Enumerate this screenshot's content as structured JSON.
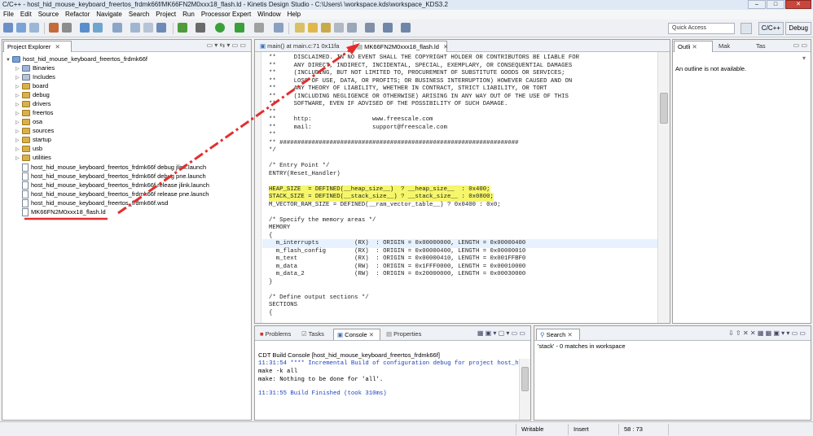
{
  "window": {
    "title": "C/C++ - host_hid_mouse_keyboard_freertos_frdmk66f/MK66FN2M0xxx18_flash.ld - Kinetis Design Studio - C:\\Users\\          \\workspace.kds\\workspace_KDS3.2",
    "min": "–",
    "max": "□",
    "close": "✕"
  },
  "menu": [
    "File",
    "Edit",
    "Source",
    "Refactor",
    "Navigate",
    "Search",
    "Project",
    "Run",
    "Processor Expert",
    "Window",
    "Help"
  ],
  "toolbar": {
    "quick_access": "Quick Access",
    "perspective_cpp": "C/C++",
    "perspective_debug": "Debug"
  },
  "project_explorer": {
    "tab_label": "Project Explorer",
    "project": "host_hid_mouse_keyboard_freertos_frdmk66f",
    "folders": [
      "Binaries",
      "Includes",
      "board",
      "debug",
      "drivers",
      "freertos",
      "osa",
      "sources",
      "startup",
      "usb",
      "utilities"
    ],
    "files": [
      "host_hid_mouse_keyboard_freertos_frdmk66f debug jlink.launch",
      "host_hid_mouse_keyboard_freertos_frdmk66f debug pne.launch",
      "host_hid_mouse_keyboard_freertos_frdmk66f release jlink.launch",
      "host_hid_mouse_keyboard_freertos_frdmk66f release pne.launch",
      "host_hid_mouse_keyboard_freertos_frdmk66f.wsd",
      "MK66FN2M0xxx18_flash.ld"
    ]
  },
  "editor": {
    "tabs": [
      "main() at main.c:71 0x11fa",
      "MK66FN2M0xxx18_flash.ld"
    ],
    "lines": [
      "**     DISCLAIMED. IN NO EVENT SHALL THE COPYRIGHT HOLDER OR CONTRIBUTORS BE LIABLE FOR",
      "**     ANY DIRECT, INDIRECT, INCIDENTAL, SPECIAL, EXEMPLARY, OR CONSEQUENTIAL DAMAGES",
      "**     (INCLUDING, BUT NOT LIMITED TO, PROCUREMENT OF SUBSTITUTE GOODS OR SERVICES;",
      "**     LOSS OF USE, DATA, OR PROFITS; OR BUSINESS INTERRUPTION) HOWEVER CAUSED AND ON",
      "**     ANY THEORY OF LIABILITY, WHETHER IN CONTRACT, STRICT LIABILITY, OR TORT",
      "**     (INCLUDING NEGLIGENCE OR OTHERWISE) ARISING IN ANY WAY OUT OF THE USE OF THIS",
      "**     SOFTWARE, EVEN IF ADVISED OF THE POSSIBILITY OF SUCH DAMAGE.",
      "**",
      "**     http:                 www.freescale.com",
      "**     mail:                 support@freescale.com",
      "**",
      "** ###################################################################",
      "*/",
      "",
      "/* Entry Point */",
      "ENTRY(Reset_Handler)",
      "",
      "HEAP_SIZE  = DEFINED(__heap_size__)  ? __heap_size__  : 0x400;",
      "STACK_SIZE = DEFINED(__stack_size__) ? __stack_size__ : 0x0800;",
      "M_VECTOR_RAM_SIZE = DEFINED(__ram_vector_table__) ? 0x0400 : 0x0;",
      "",
      "/* Specify the memory areas */",
      "MEMORY",
      "{",
      "  m_interrupts          (RX)  : ORIGIN = 0x00000000, LENGTH = 0x00000400",
      "  m_flash_config        (RX)  : ORIGIN = 0x00000400, LENGTH = 0x00000010",
      "  m_text                (RX)  : ORIGIN = 0x00000410, LENGTH = 0x001FFBF0",
      "  m_data                (RW)  : ORIGIN = 0x1FFF0000, LENGTH = 0x00010000",
      "  m_data_2              (RW)  : ORIGIN = 0x20000000, LENGTH = 0x00030000",
      "}",
      "",
      "/* Define output sections */",
      "SECTIONS",
      "{"
    ]
  },
  "outline": {
    "tab_label": "Outli",
    "tab2_label": "Mak",
    "tab3_label": "Tas",
    "message": "An outline is not available."
  },
  "console": {
    "tabs": [
      "Problems",
      "Tasks",
      "Console",
      "Properties"
    ],
    "header": "CDT Build Console [host_hid_mouse_keyboard_freertos_frdmk66f]",
    "lines": [
      "11:31:54 **** Incremental Build of configuration debug for project host_hi",
      "make -k all",
      "make: Nothing to be done for 'all'.",
      "",
      "11:31:55 Build Finished (took 310ms)"
    ]
  },
  "search": {
    "tab_label": "Search",
    "result": "'stack' - 0 matches in workspace"
  },
  "statusbar": {
    "writable": "Writable",
    "insert": "Insert",
    "position": "58 : 73"
  },
  "colors": {
    "highlight": "#f6f66b",
    "annotation": "#e32e2e"
  }
}
